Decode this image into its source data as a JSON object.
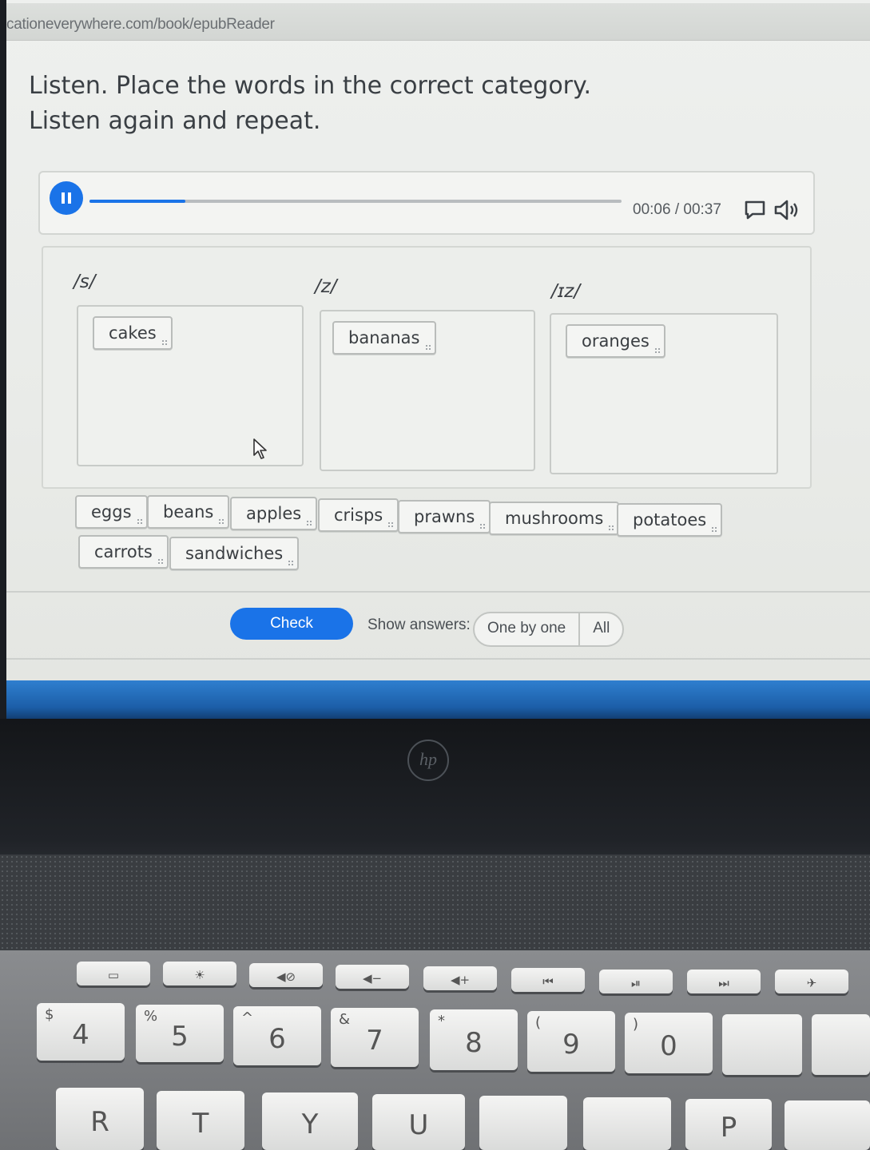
{
  "browser": {
    "url": "cationeverywhere.com/book/epubReader"
  },
  "exercise": {
    "instruction_line1": "Listen. Place the words in the correct category.",
    "instruction_line2": "Listen again and repeat."
  },
  "player": {
    "time": "00:06 / 00:37",
    "progress_fraction": 0.18,
    "state": "playing"
  },
  "categories": [
    {
      "label": "/s/",
      "words": [
        "cakes"
      ]
    },
    {
      "label": "/z/",
      "words": [
        "bananas"
      ]
    },
    {
      "label": "/ɪz/",
      "words": [
        "oranges"
      ]
    }
  ],
  "word_bank": [
    "eggs",
    "beans",
    "apples",
    "crisps",
    "prawns",
    "mushrooms",
    "potatoes",
    "carrots",
    "sandwiches"
  ],
  "controls": {
    "check_label": "Check",
    "show_answers_label": "Show answers:",
    "one_by_one_label": "One by one",
    "all_label": "All"
  },
  "laptop": {
    "brand": "hp",
    "number_keys": [
      {
        "main": "4",
        "sub": "$"
      },
      {
        "main": "5",
        "sub": "%"
      },
      {
        "main": "6",
        "sub": "^"
      },
      {
        "main": "7",
        "sub": "&"
      },
      {
        "main": "8",
        "sub": "*"
      },
      {
        "main": "9",
        "sub": "("
      },
      {
        "main": "0",
        "sub": ")"
      }
    ],
    "letter_keys": [
      "R",
      "T",
      "Y",
      "U",
      "P"
    ]
  },
  "colors": {
    "accent": "#1a73e8"
  }
}
